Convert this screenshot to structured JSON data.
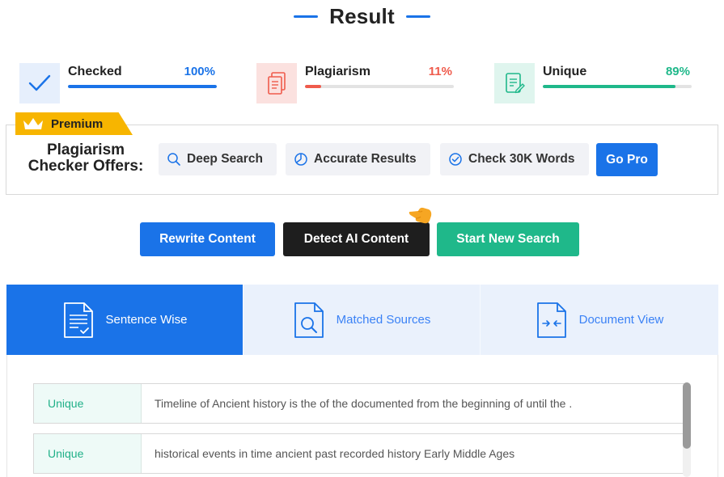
{
  "header": {
    "title": "Result"
  },
  "stats": [
    {
      "label": "Checked",
      "percent": "100%",
      "value": 100,
      "color": "#1a73e8",
      "icon": "check-icon"
    },
    {
      "label": "Plagiarism",
      "percent": "11%",
      "value": 11,
      "color": "#ef5b4c",
      "icon": "copy-document-icon"
    },
    {
      "label": "Unique",
      "percent": "89%",
      "value": 89,
      "color": "#1fb88a",
      "icon": "document-edit-icon"
    }
  ],
  "premium": {
    "badge": "Premium",
    "offers_line1": "Plagiarism",
    "offers_line2": "Checker Offers:",
    "features": [
      {
        "label": "Deep Search",
        "icon": "search-icon"
      },
      {
        "label": "Accurate Results",
        "icon": "pie-chart-icon"
      },
      {
        "label": "Check 30K Words",
        "icon": "check-circle-icon"
      }
    ],
    "go_pro": "Go Pro"
  },
  "actions": {
    "rewrite": "Rewrite Content",
    "detect_ai": "Detect AI Content",
    "new_search": "Start New Search"
  },
  "tabs": [
    {
      "label": "Sentence Wise",
      "icon": "document-lines-icon",
      "active": true
    },
    {
      "label": "Matched Sources",
      "icon": "document-search-icon",
      "active": false
    },
    {
      "label": "Document View",
      "icon": "document-compare-icon",
      "active": false
    }
  ],
  "results": [
    {
      "status": "Unique",
      "text": "Timeline of Ancient history is the of the documented from the beginning of until the ."
    },
    {
      "status": "Unique",
      "text": "historical events in time ancient past recorded history Early Middle Ages"
    }
  ],
  "colors": {
    "primary": "#1a73e8",
    "danger": "#ef5b4c",
    "success": "#1fb88a",
    "dark": "#1e1e1e",
    "premium": "#f7b500"
  }
}
